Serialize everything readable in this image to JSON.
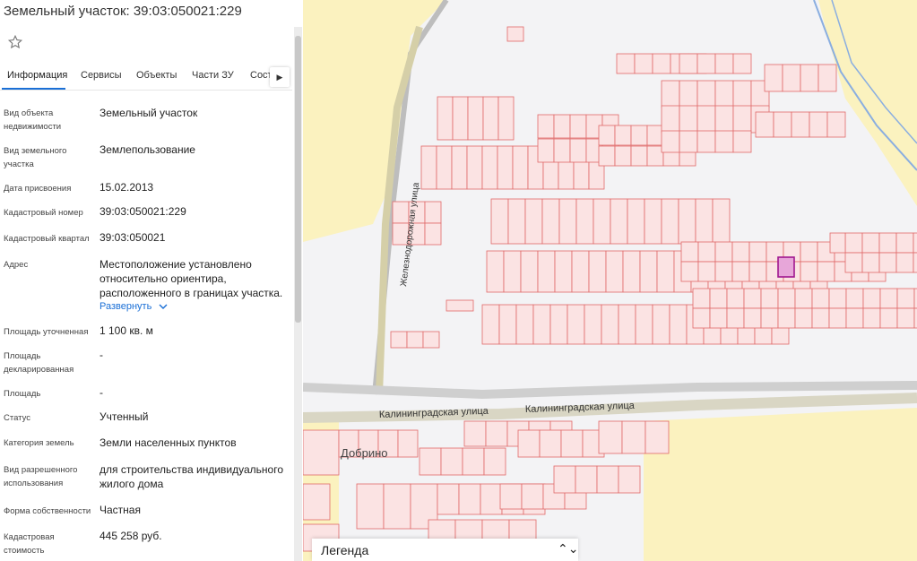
{
  "panel": {
    "title": "Земельный участок: 39:03:050021:229",
    "tabs": [
      "Информация",
      "Сервисы",
      "Объекты",
      "Части ЗУ",
      "Соста"
    ],
    "expand_label": "Развернуть",
    "rows": [
      {
        "label": "Вид объекта недвижимости",
        "value": "Земельный участок"
      },
      {
        "label": "Вид земельного участка",
        "value": "Землепользование"
      },
      {
        "label": "Дата присвоения",
        "value": "15.02.2013"
      },
      {
        "label": "Кадастровый номер",
        "value": "39:03:050021:229"
      },
      {
        "label": "Кадастровый квартал",
        "value": "39:03:050021"
      },
      {
        "label": "Адрес",
        "value": "Местоположение установлено относительно ориентира, расположенного в границах участка."
      },
      {
        "label": "Площадь уточненная",
        "value": "1 100 кв. м"
      },
      {
        "label": "Площадь декларированная",
        "value": "-"
      },
      {
        "label": "Площадь",
        "value": "-"
      },
      {
        "label": "Статус",
        "value": "Учтенный"
      },
      {
        "label": "Категория земель",
        "value": "Земли населенных пунктов"
      },
      {
        "label": "Вид разрешенного использования",
        "value": "для строительства индивидуального жилого дома"
      },
      {
        "label": "Форма собственности",
        "value": "Частная"
      },
      {
        "label": "Кадастровая стоимость",
        "value": "445 258 руб."
      }
    ]
  },
  "map": {
    "street_labels": [
      "Калининградская улица",
      "Калининградская улица",
      "Железнодорожная улица"
    ],
    "place_label": "Добрино",
    "legend_label": "Легенда",
    "colors": {
      "parcel_fill": "#fbe3e3",
      "parcel_stroke": "#e06a6a",
      "selected_fill": "#e7a6d9",
      "selected_stroke": "#a0178f",
      "field": "#fbf2bf",
      "road": "#d9d6c4"
    }
  }
}
